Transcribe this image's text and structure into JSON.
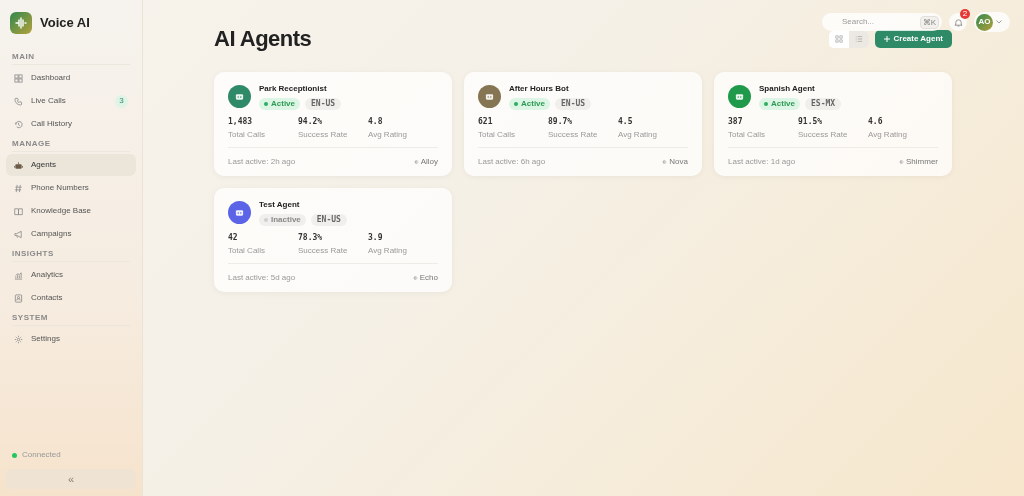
{
  "app": {
    "name": "Voice AI"
  },
  "sidebar": {
    "sections": [
      {
        "title": "MAIN",
        "items": [
          {
            "label": "Dashboard",
            "selected": false
          },
          {
            "label": "Live Calls",
            "selected": false,
            "badge": "3"
          },
          {
            "label": "Call History",
            "selected": false
          }
        ]
      },
      {
        "title": "MANAGE",
        "items": [
          {
            "label": "Agents",
            "selected": true
          },
          {
            "label": "Phone Numbers",
            "selected": false
          },
          {
            "label": "Knowledge Base",
            "selected": false
          },
          {
            "label": "Campaigns",
            "selected": false
          }
        ]
      },
      {
        "title": "INSIGHTS",
        "items": [
          {
            "label": "Analytics",
            "selected": false
          },
          {
            "label": "Contacts",
            "selected": false
          }
        ]
      },
      {
        "title": "SYSTEM",
        "items": [
          {
            "label": "Settings",
            "selected": false
          }
        ]
      }
    ],
    "connection": {
      "label": "Connected",
      "color": "#22c55e"
    },
    "collapse": "«"
  },
  "header": {
    "search": {
      "placeholder": "Search...",
      "shortcut": "⌘K"
    },
    "notifications": "2",
    "avatar": "AO",
    "view": [
      {
        "kind": "grid",
        "selected": false
      },
      {
        "kind": "list",
        "selected": true
      }
    ],
    "create_button": "Create Agent"
  },
  "page": {
    "title": "AI Agents"
  },
  "agents": [
    {
      "name": "Park Receptionist",
      "color": "#2f8a68",
      "active": true,
      "status": "Active",
      "language": "EN-US",
      "stats": [
        {
          "value": "1,483",
          "label": "Total Calls"
        },
        {
          "value": "94.2%",
          "label": "Success Rate"
        },
        {
          "value": "4.8",
          "label": "Avg Rating"
        }
      ],
      "last_active": "Last active: 2h ago",
      "voice": "Alloy"
    },
    {
      "name": "After Hours Bot",
      "color": "#857552",
      "active": true,
      "status": "Active",
      "language": "EN-US",
      "stats": [
        {
          "value": "621",
          "label": "Total Calls"
        },
        {
          "value": "89.7%",
          "label": "Success Rate"
        },
        {
          "value": "4.5",
          "label": "Avg Rating"
        }
      ],
      "last_active": "Last active: 6h ago",
      "voice": "Nova"
    },
    {
      "name": "Spanish Agent",
      "color": "#1f9a4a",
      "active": true,
      "status": "Active",
      "language": "ES-MX",
      "stats": [
        {
          "value": "387",
          "label": "Total Calls"
        },
        {
          "value": "91.5%",
          "label": "Success Rate"
        },
        {
          "value": "4.6",
          "label": "Avg Rating"
        }
      ],
      "last_active": "Last active: 1d ago",
      "voice": "Shimmer"
    },
    {
      "name": "Test Agent",
      "color": "#5b63e6",
      "active": false,
      "status": "Inactive",
      "language": "EN-US",
      "stats": [
        {
          "value": "42",
          "label": "Total Calls"
        },
        {
          "value": "78.3%",
          "label": "Success Rate"
        },
        {
          "value": "3.9",
          "label": "Avg Rating"
        }
      ],
      "last_active": "Last active: 5d ago",
      "voice": "Echo"
    }
  ]
}
